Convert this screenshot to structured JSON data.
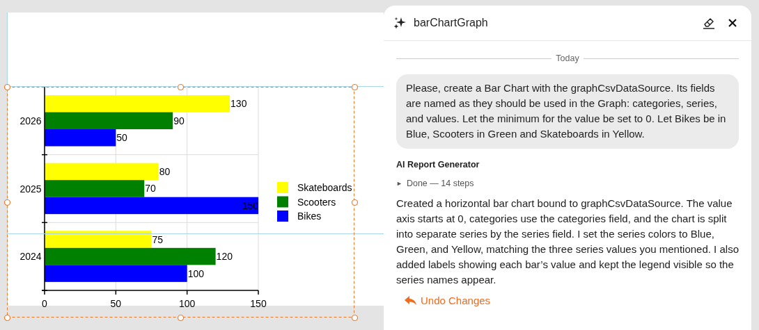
{
  "chart": {
    "chart_data": {
      "type": "bar",
      "orientation": "horizontal",
      "categories": [
        "2026",
        "2025",
        "2024"
      ],
      "series": [
        {
          "name": "Skateboards",
          "color": "#ffff00",
          "values": [
            130,
            80,
            75
          ]
        },
        {
          "name": "Scooters",
          "color": "#008000",
          "values": [
            90,
            70,
            120
          ]
        },
        {
          "name": "Bikes",
          "color": "#0000ff",
          "values": [
            50,
            150,
            100
          ]
        }
      ],
      "xlim": [
        0,
        150
      ],
      "xticks": [
        0,
        50,
        100,
        150
      ],
      "data_labels": true,
      "legend": true
    }
  },
  "panel": {
    "title": "barChartGraph",
    "divider": "Today",
    "user_message": "Please, create a Bar Chart with the graphCsvDataSource. Its fields are named as they should be used in the Graph: categories, series, and values. Let the minimum for the value be set to 0. Let Bikes be in Blue, Scooters in Green and Skateboards in Yellow.",
    "assistant_name": "AI Report Generator",
    "steps_toggle": "►",
    "steps_summary": "Done — 14 steps",
    "expanded": false,
    "reply": "Created a horizontal bar chart bound to graphCsvDataSource. The value axis starts at 0, categories use the categories field, and the chart is split into separate series by the series field. I set the series colors to Blue, Green, and Yellow, matching the three series values you mentioned. I also added labels showing each bar’s value and kept the legend visible so the series names appear.",
    "undo_button": "Undo Changes"
  }
}
